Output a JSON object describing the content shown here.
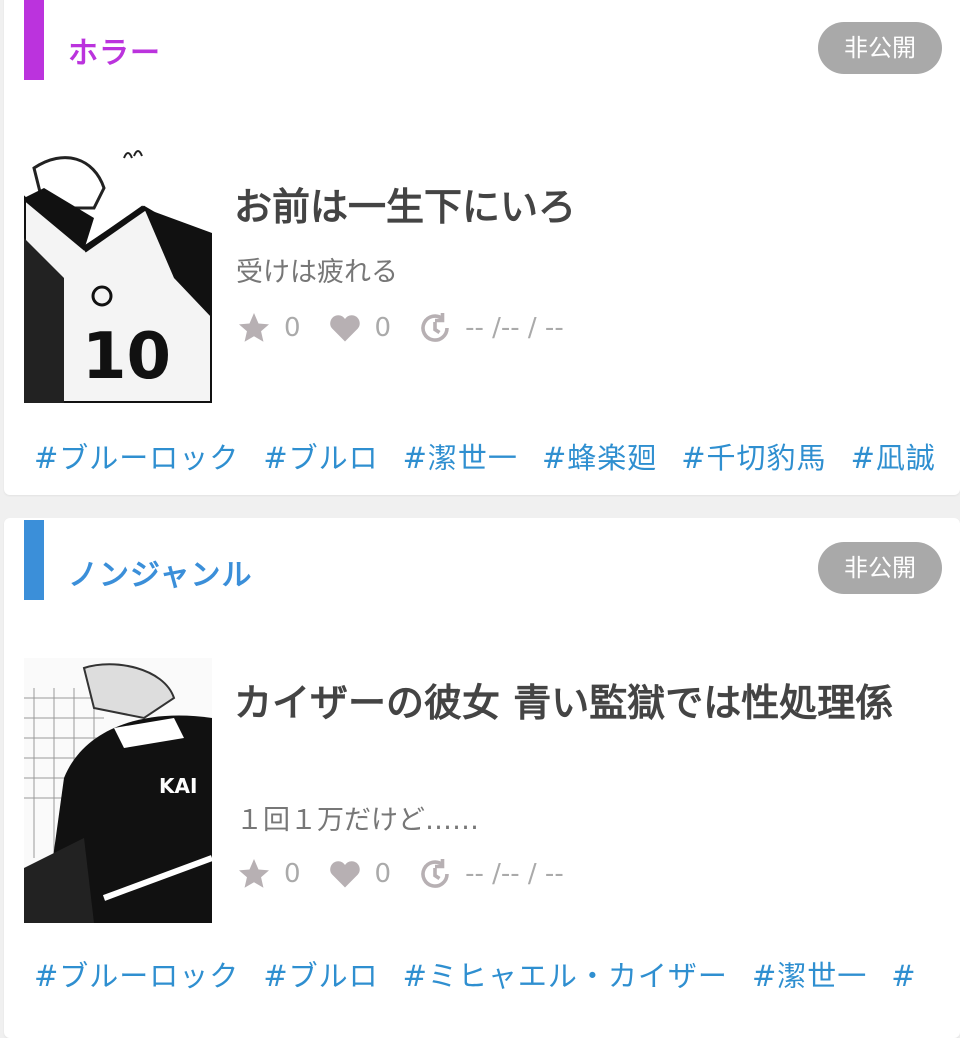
{
  "colors": {
    "horror_accent": "#bb33dd",
    "nongenre_accent": "#3b8fd9",
    "tag_color": "#2f8fd0",
    "badge_bg": "#a9a9a9"
  },
  "works": [
    {
      "genre": "ホラー",
      "visibility_badge": "非公開",
      "title": "お前は一生下にいろ",
      "subtitle": "受けは疲れる",
      "stars": "0",
      "likes": "0",
      "updated": "-- /-- / --",
      "tags": [
        "#ブルーロック",
        "#ブルロ",
        "#潔世一",
        "#蜂楽廻",
        "#千切豹馬",
        "#凪誠"
      ]
    },
    {
      "genre": "ノンジャンル",
      "visibility_badge": "非公開",
      "title": "カイザーの彼女 青い監獄では性処理係",
      "subtitle": "１回１万だけど……",
      "stars": "0",
      "likes": "0",
      "updated": "-- /-- / --",
      "tags": [
        "#ブルーロック",
        "#ブルロ",
        "#ミヒャエル・カイザー",
        "#潔世一",
        "#"
      ]
    }
  ]
}
